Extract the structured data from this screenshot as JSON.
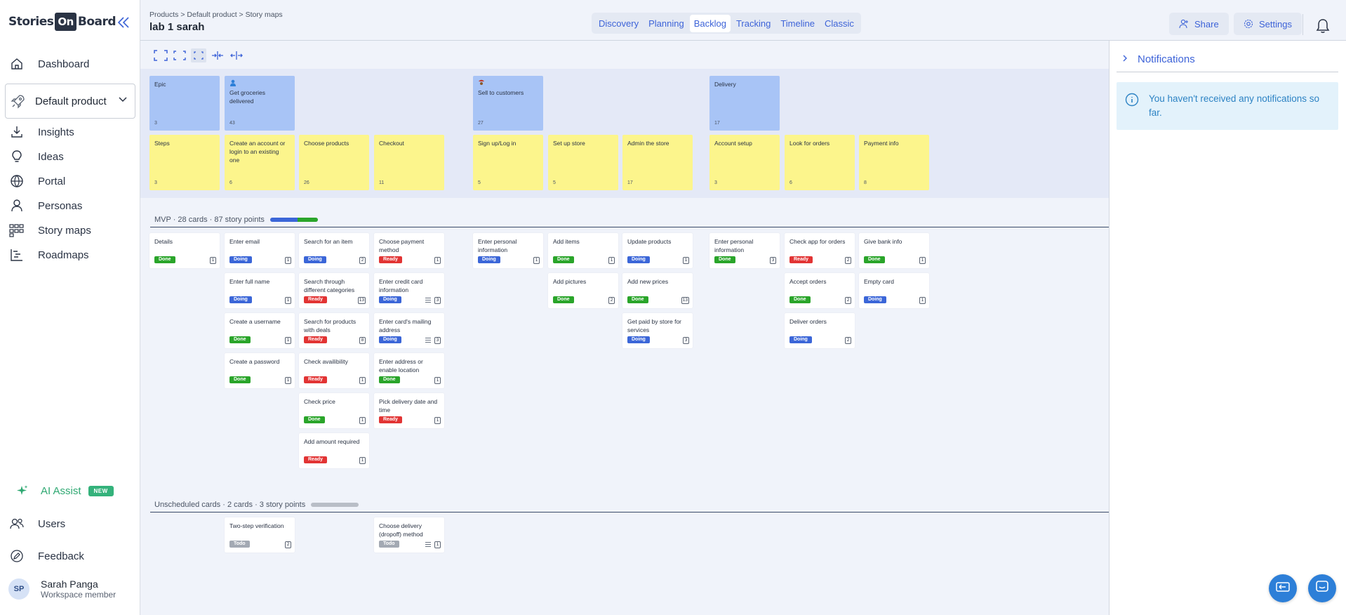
{
  "sidebar": {
    "logo_left": "Stories",
    "logo_on": "On",
    "logo_right": "Board",
    "items": [
      {
        "label": "Dashboard",
        "icon": "home-icon"
      },
      {
        "label": "Insights",
        "icon": "download-icon"
      },
      {
        "label": "Ideas",
        "icon": "lightbulb-icon"
      },
      {
        "label": "Portal",
        "icon": "globe-icon"
      },
      {
        "label": "Personas",
        "icon": "person-icon"
      },
      {
        "label": "Story maps",
        "icon": "storymap-icon"
      },
      {
        "label": "Roadmaps",
        "icon": "roadmap-icon"
      }
    ],
    "product": "Default product",
    "ai_assist": "AI Assist",
    "ai_badge": "NEW",
    "users": "Users",
    "feedback": "Feedback",
    "user": {
      "initials": "SP",
      "name": "Sarah Panga",
      "role": "Workspace member"
    }
  },
  "header": {
    "breadcrumb": "Products > Default product > Story maps",
    "title": "lab 1 sarah",
    "tabs": [
      "Discovery",
      "Planning",
      "Backlog",
      "Tracking",
      "Timeline",
      "Classic"
    ],
    "active_tab": "Backlog",
    "share": "Share",
    "settings": "Settings"
  },
  "colors": {
    "accent": "#3d63d8",
    "epic": "#a8c4f6",
    "step": "#fcf58c",
    "done": "#2aa52a",
    "doing": "#3b66d8",
    "ready": "#e23434",
    "todo": "#a3a9b3"
  },
  "epics": [
    {
      "title": "Epic",
      "count": "3",
      "col": 0
    },
    {
      "title": "Get groceries delivered",
      "count": "43",
      "col": 1,
      "icon": "person-icon"
    },
    {
      "title": "Sell to customers",
      "count": "27",
      "col": 4,
      "icon": "persona-icon"
    },
    {
      "title": "Delivery",
      "count": "17",
      "col": 7
    }
  ],
  "steps": [
    {
      "title": "Steps",
      "count": "3"
    },
    {
      "title": "Create an account or login to an existing one",
      "count": "6"
    },
    {
      "title": "Choose products",
      "count": "26"
    },
    {
      "title": "Checkout",
      "count": "11"
    },
    {
      "title": "Sign up/Log in",
      "count": "5"
    },
    {
      "title": "Set up store",
      "count": "5"
    },
    {
      "title": "Admin the store",
      "count": "17"
    },
    {
      "title": "Account setup",
      "count": "3"
    },
    {
      "title": "Look for orders",
      "count": "6"
    },
    {
      "title": "Payment info",
      "count": "8"
    }
  ],
  "mvp": {
    "label": "MVP · 28 cards · 87 story points",
    "doing_fraction": 0.58,
    "done_fraction": 0.42,
    "columns": [
      [
        {
          "title": "Details",
          "status": "Done",
          "est": "1"
        }
      ],
      [
        {
          "title": "Enter email",
          "status": "Doing",
          "est": "1"
        },
        {
          "title": "Enter full name",
          "status": "Doing",
          "est": "1"
        },
        {
          "title": "Create a username",
          "status": "Done",
          "est": "1"
        },
        {
          "title": "Create a password",
          "status": "Done",
          "est": "1"
        }
      ],
      [
        {
          "title": "Search for an item",
          "status": "Doing",
          "est": "2"
        },
        {
          "title": "Search through different categories",
          "status": "Ready",
          "est": "13"
        },
        {
          "title": "Search for products with deals",
          "status": "Ready",
          "est": "8"
        },
        {
          "title": "Check availibility",
          "status": "Ready",
          "est": "1"
        },
        {
          "title": "Check price",
          "status": "Done",
          "est": "1"
        },
        {
          "title": "Add amount required",
          "status": "Ready",
          "est": "1"
        }
      ],
      [
        {
          "title": "Choose payment method",
          "status": "Ready",
          "est": "1"
        },
        {
          "title": "Enter credit card information",
          "status": "Doing",
          "est": "3",
          "desc": true
        },
        {
          "title": "Enter card's mailing address",
          "status": "Doing",
          "est": "3",
          "desc": true
        },
        {
          "title": "Enter address or enable location",
          "status": "Done",
          "est": "1"
        },
        {
          "title": "Pick delivery date and time",
          "status": "Ready",
          "est": "1"
        }
      ],
      [
        {
          "title": "Enter personal information",
          "status": "Doing",
          "est": "1"
        }
      ],
      [
        {
          "title": "Add items",
          "status": "Done",
          "est": "1"
        },
        {
          "title": "Add pictures",
          "status": "Done",
          "est": "2"
        }
      ],
      [
        {
          "title": "Update products",
          "status": "Doing",
          "est": "1"
        },
        {
          "title": "Add new prices",
          "status": "Done",
          "est": "13"
        },
        {
          "title": "Get paid by store for services",
          "status": "Doing",
          "est": "3"
        }
      ],
      [
        {
          "title": "Enter personal information",
          "status": "Done",
          "est": "3"
        }
      ],
      [
        {
          "title": "Check app for orders",
          "status": "Ready",
          "est": "2"
        },
        {
          "title": "Accept orders",
          "status": "Done",
          "est": "2"
        },
        {
          "title": "Deliver orders",
          "status": "Doing",
          "est": "2"
        }
      ],
      [
        {
          "title": "Give bank info",
          "status": "Done",
          "est": "1"
        },
        {
          "title": "Empty card",
          "status": "Doing",
          "est": "1"
        }
      ]
    ]
  },
  "unscheduled": {
    "label": "Unscheduled cards · 2 cards · 3 story points",
    "cards": [
      {
        "title": "Two-step verification",
        "status": "Todo",
        "est": "2",
        "col": 1
      },
      {
        "title": "Choose delivery (dropoff) method",
        "status": "Todo",
        "est": "1",
        "col": 3,
        "desc": true
      }
    ]
  },
  "notifications": {
    "title": "Notifications",
    "message": "You haven't received any notifications so far."
  }
}
